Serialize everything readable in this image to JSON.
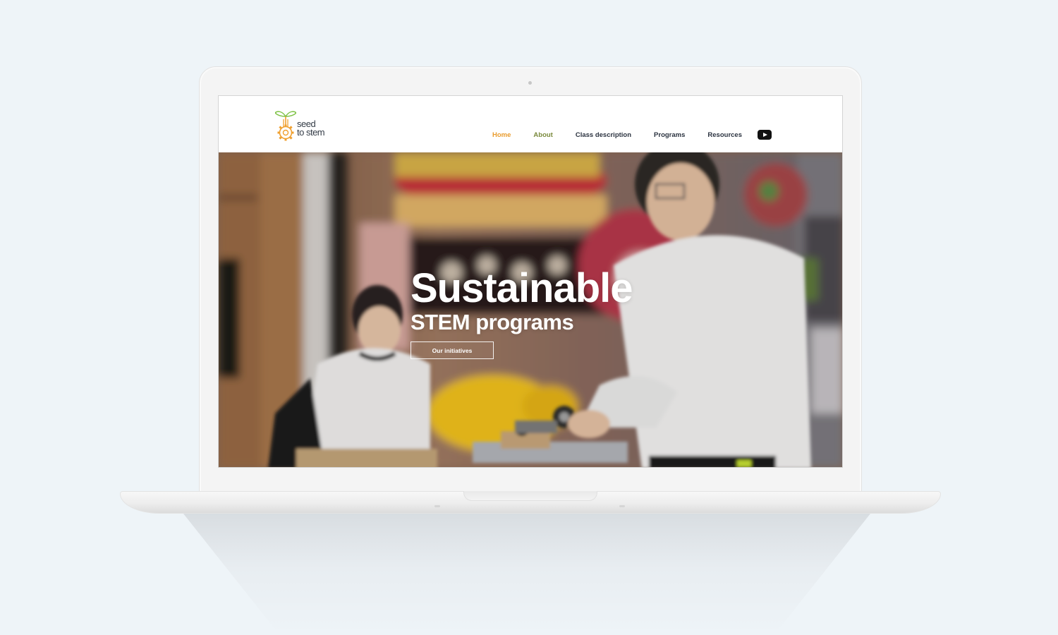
{
  "site": {
    "logo": {
      "line1": "seed",
      "line2": "to stem"
    },
    "nav": {
      "items": [
        {
          "label": "Home"
        },
        {
          "label": "About"
        },
        {
          "label": "Class description"
        },
        {
          "label": "Programs"
        },
        {
          "label": "Resources"
        }
      ],
      "youtube_icon": "youtube-icon"
    },
    "hero": {
      "title": "Sustainable",
      "subtitle": "STEM programs",
      "button_label": "Our initiatives"
    }
  },
  "colors": {
    "background": "#eef4f8",
    "nav_active": "#e99c2e",
    "nav_about": "#7a8a3c",
    "nav_text": "#2b3340",
    "logo_green": "#7cc142",
    "logo_orange": "#f0a030"
  }
}
